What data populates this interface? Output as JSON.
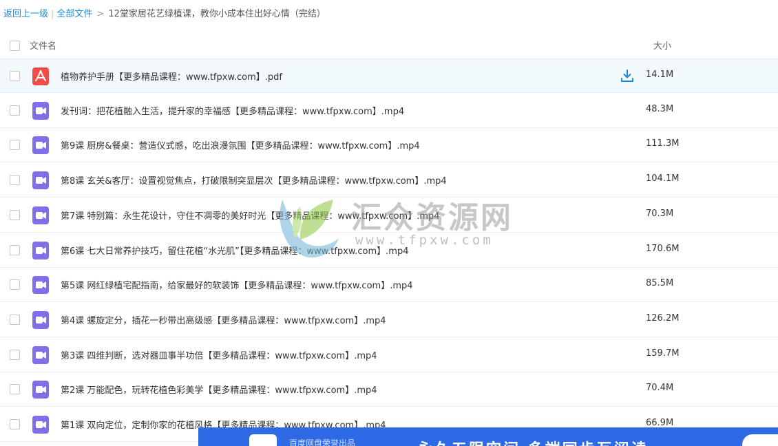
{
  "breadcrumb": {
    "back": "返回上一级",
    "all_files": "全部文件",
    "separator": "|",
    "arrow": ">",
    "current": "12堂家居花艺绿植课，教你小成本住出好心情（完结）"
  },
  "table": {
    "col_name": "文件名",
    "col_size": "大小"
  },
  "files": [
    {
      "name": "植物养护手册【更多精品课程：www.tfpxw.com】.pdf",
      "size": "14.1M",
      "type": "pdf-icon",
      "selected": true
    },
    {
      "name": "发刊词：把花植融入生活，提升家的幸福感【更多精品课程：www.tfpxw.com】.mp4",
      "size": "48.3M",
      "type": "video-icon"
    },
    {
      "name": "第9课 厨房&餐桌：营造仪式感，吃出浪漫氛围【更多精品课程：www.tfpxw.com】.mp4",
      "size": "111.3M",
      "type": "video-icon"
    },
    {
      "name": "第8课 玄关&客厅：设置视觉焦点，打破限制突显层次【更多精品课程：www.tfpxw.com】.mp4",
      "size": "104.1M",
      "type": "video-icon"
    },
    {
      "name": "第7课 特别篇：永生花设计，守住不凋零的美好时光【更多精品课程：www.tfpxw.com】.mp4",
      "size": "70.3M",
      "type": "video-icon"
    },
    {
      "name": "第6课 七大日常养护技巧，留住花植“水光肌”【更多精品课程：www.tfpxw.com】.mp4",
      "size": "170.6M",
      "type": "video-icon"
    },
    {
      "name": "第5课 网红绿植宅配指南，给家最好的软装饰【更多精品课程：www.tfpxw.com】.mp4",
      "size": "85.5M",
      "type": "video-icon"
    },
    {
      "name": "第4课 螺旋定分，插花一秒带出高级感【更多精品课程：www.tfpxw.com】.mp4",
      "size": "126.2M",
      "type": "video-icon"
    },
    {
      "name": "第3课 四维判断，选对器皿事半功倍【更多精品课程：www.tfpxw.com】.mp4",
      "size": "159.7M",
      "type": "video-icon"
    },
    {
      "name": "第2课 万能配色，玩转花植色彩美学【更多精品课程：www.tfpxw.com】.mp4",
      "size": "70.4M",
      "type": "video-icon"
    },
    {
      "name": "第1课 双向定位，定制你家的花植风格【更多精品课程：www.tfpxw.com】.mp4",
      "size": "66.9M",
      "type": "video-icon"
    }
  ],
  "watermark": {
    "cn": "汇众资源网",
    "en": "www.tfpxw.com"
  },
  "banner": {
    "small_text": "百度网盘荣誉出品",
    "big_text": "永久五限空间 多端同步互阅读"
  },
  "colors": {
    "link": "#1a8ad8",
    "video_icon": "#7f6fe9",
    "pdf_icon": "#f04f47",
    "selected_row": "#f2f9fd",
    "download_icon": "#1a8ad8",
    "banner": "#2f6ae6"
  }
}
